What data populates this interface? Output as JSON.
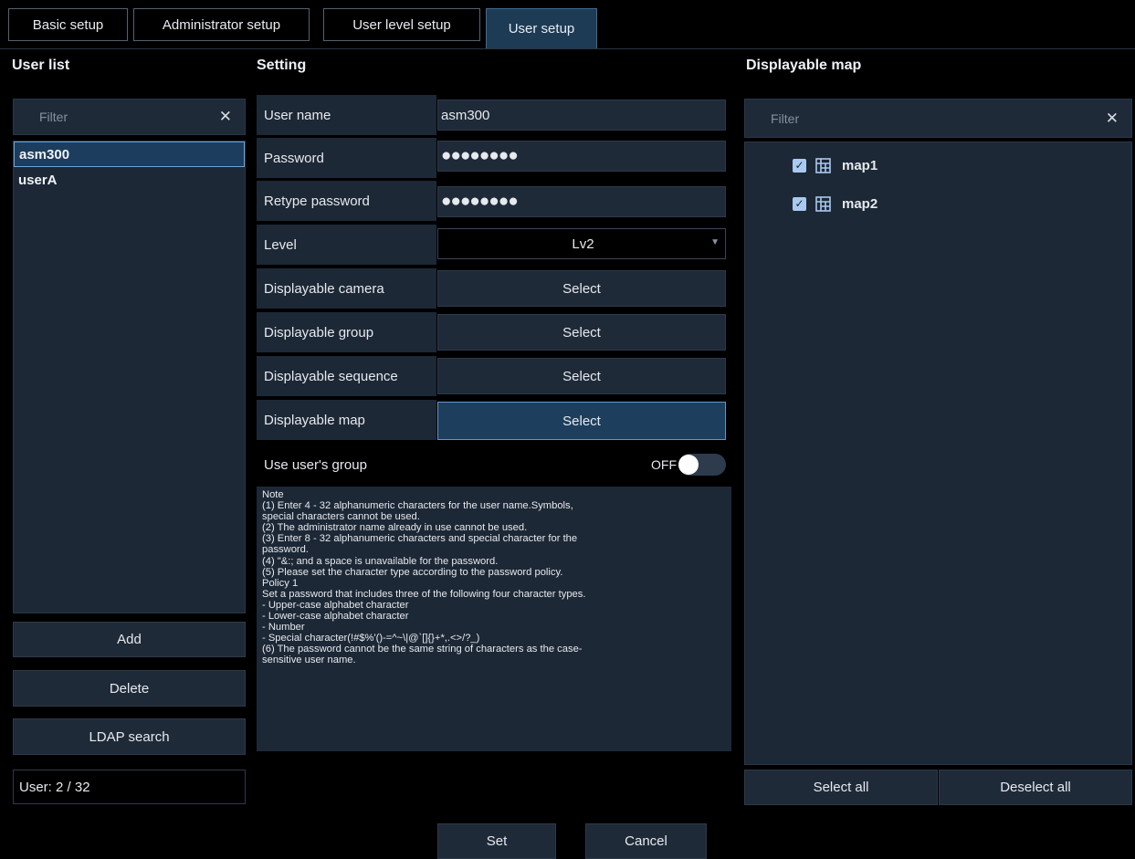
{
  "tabs": [
    {
      "label": "Basic setup",
      "active": false
    },
    {
      "label": "Administrator setup",
      "active": false
    },
    {
      "label": "User level setup",
      "active": false
    },
    {
      "label": "User setup",
      "active": true
    }
  ],
  "user_list": {
    "title": "User list",
    "filter_placeholder": "Filter",
    "clear_icon": "close-icon",
    "users": [
      "asm300",
      "userA"
    ],
    "selected_user": "asm300",
    "buttons": {
      "add": "Add",
      "delete": "Delete",
      "ldap": "LDAP search"
    },
    "count_label": "User:",
    "count_value": "2",
    "count_max": "/ 32"
  },
  "setting": {
    "title": "Setting",
    "rows": {
      "user_name": {
        "label": "User name",
        "value": "asm300"
      },
      "password": {
        "label": "Password",
        "value": "●●●●●●●●"
      },
      "retype_password": {
        "label": "Retype password",
        "value": "●●●●●●●●"
      },
      "level": {
        "label": "Level",
        "value": "Lv2"
      },
      "camera": {
        "label": "Displayable camera",
        "button": "Select"
      },
      "group": {
        "label": "Displayable group",
        "button": "Select"
      },
      "sequence": {
        "label": "Displayable sequence",
        "button": "Select"
      },
      "map": {
        "label": "Displayable map",
        "button": "Select"
      }
    },
    "use_users_group": {
      "label": "Use user's group",
      "state": "OFF"
    },
    "note_lines": [
      "Note",
      "(1) Enter 4 - 32 alphanumeric characters for the user name.Symbols,",
      "special characters cannot be used.",
      "(2) The administrator name already in use cannot be used.",
      "(3) Enter 8 - 32 alphanumeric characters and special character for the",
      "password.",
      "(4) \"&:; and a space is unavailable for the password.",
      "(5) Please set the character type according to the password policy.",
      "Policy 1",
      "Set a password that includes three of the following four character types.",
      "- Upper-case alphabet character",
      "- Lower-case alphabet character",
      "- Number",
      "- Special character(!#$%'()-=^~\\|@`[]{}+*,.<>/?_)",
      "(6) The password cannot be the same string of characters as the case-",
      "sensitive user name."
    ],
    "set_button": "Set",
    "cancel_button": "Cancel"
  },
  "displayable_map": {
    "title": "Displayable map",
    "filter_placeholder": "Filter",
    "clear_icon": "close-icon",
    "maps": [
      {
        "name": "map1",
        "checked": true
      },
      {
        "name": "map2",
        "checked": true
      }
    ],
    "select_all": "Select all",
    "deselect_all": "Deselect all"
  },
  "colors": {
    "background": "#000000",
    "panel": "#1d2836",
    "accent": "#1d3e5c",
    "accent_border": "#5f98cc",
    "checkbox": "#a9c9ee"
  }
}
